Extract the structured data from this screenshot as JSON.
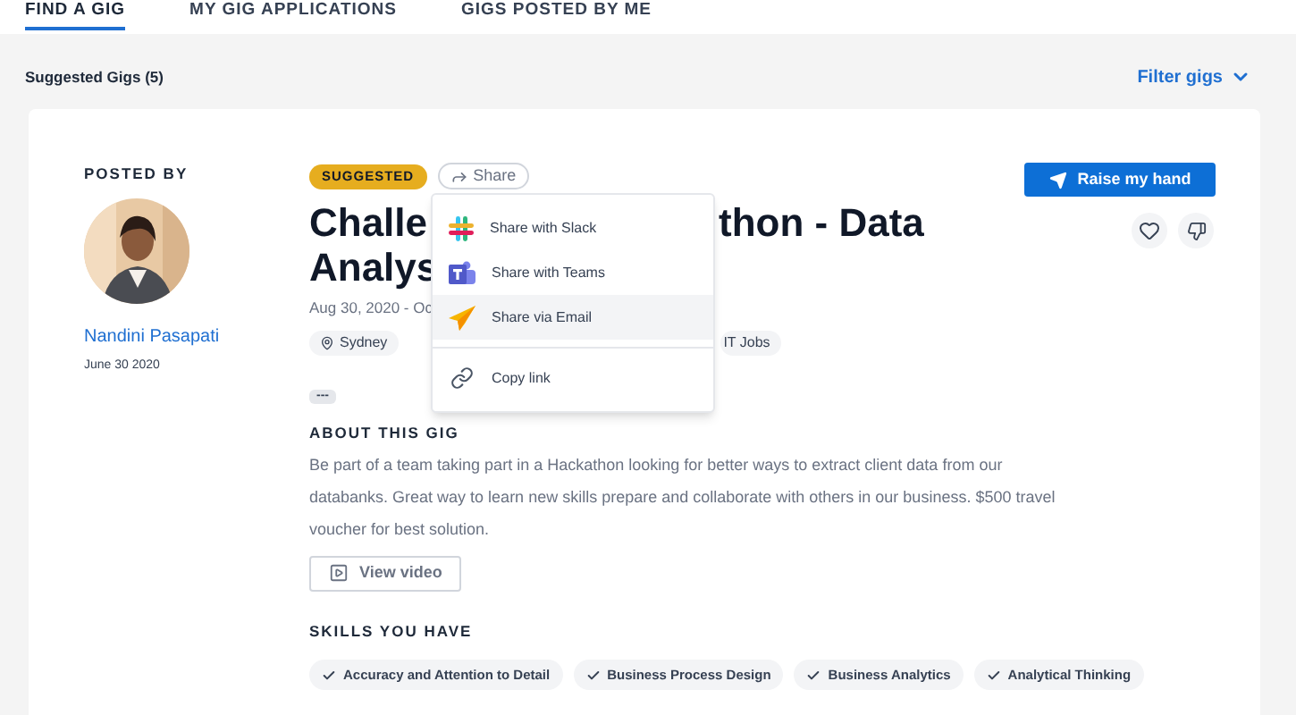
{
  "tabs": [
    {
      "label": "FIND A GIG",
      "selected": true
    },
    {
      "label": "MY GIG APPLICATIONS",
      "selected": false
    },
    {
      "label": "GIGS POSTED BY ME",
      "selected": false
    }
  ],
  "toolbar": {
    "heading": "Suggested Gigs (5)",
    "filter": "Filter gigs"
  },
  "gig": {
    "posted_by_label": "POSTED BY",
    "author": "Nandini Pasapati",
    "posted_date": "June 30 2020",
    "badge": "SUGGESTED",
    "share": "Share",
    "title_parts": [
      "Challe",
      "thon - Data",
      "Analys"
    ],
    "dates": "Aug 30, 2020 - Oc",
    "tags": [
      "Sydney",
      "IT Jobs"
    ],
    "more": "---",
    "raise": "Raise my hand",
    "about_label": "ABOUT THIS GIG",
    "about": "Be part of a team taking part in a Hackathon looking for better ways to extract client data from our databanks. Great way to learn new skills prepare and collaborate with others in our business. $500 travel voucher for best solution.",
    "video": "View video",
    "skills_label": "SKILLS YOU HAVE",
    "skills": [
      "Accuracy and Attention to Detail",
      "Business Process Design",
      "Business Analytics",
      "Analytical Thinking"
    ]
  },
  "share_menu": [
    {
      "kind": "slack",
      "label": "Share with Slack",
      "selected": false
    },
    {
      "kind": "teams",
      "label": "Share with Teams",
      "selected": false
    },
    {
      "kind": "email",
      "label": "Share via Email",
      "selected": true
    },
    {
      "kind": "link",
      "label": "Copy link",
      "selected": false
    }
  ]
}
